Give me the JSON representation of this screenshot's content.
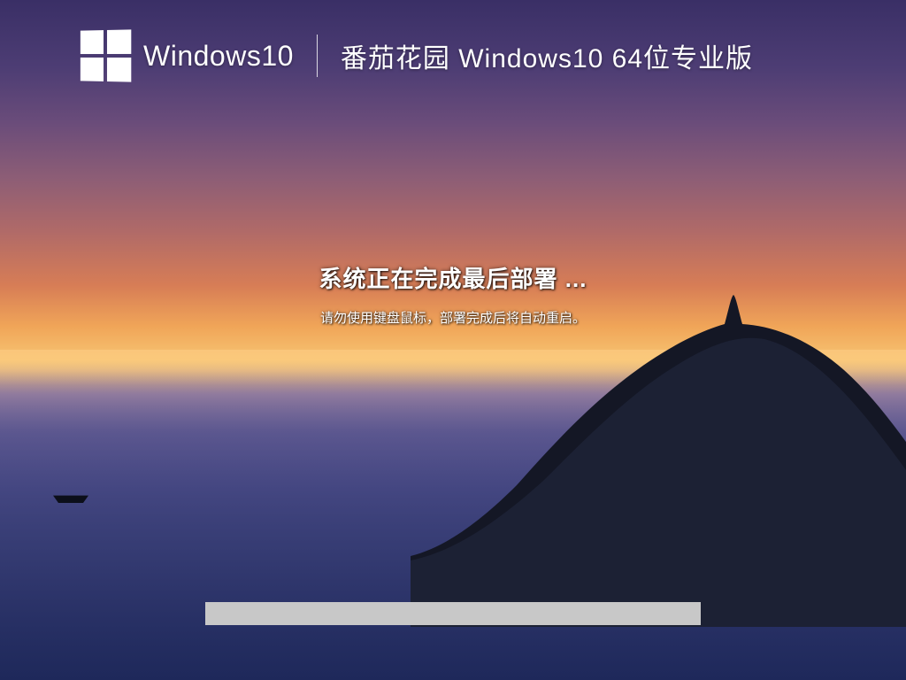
{
  "header": {
    "logo_text": "Windows10",
    "edition_text": "番茄花园 Windows10 64位专业版"
  },
  "status": {
    "primary": "系统正在完成最后部署 ...",
    "secondary": "请勿使用键盘鼠标，部署完成后将自动重启。"
  },
  "progress": {
    "percent": 0
  },
  "icons": {
    "windows_logo": "windows-logo"
  }
}
